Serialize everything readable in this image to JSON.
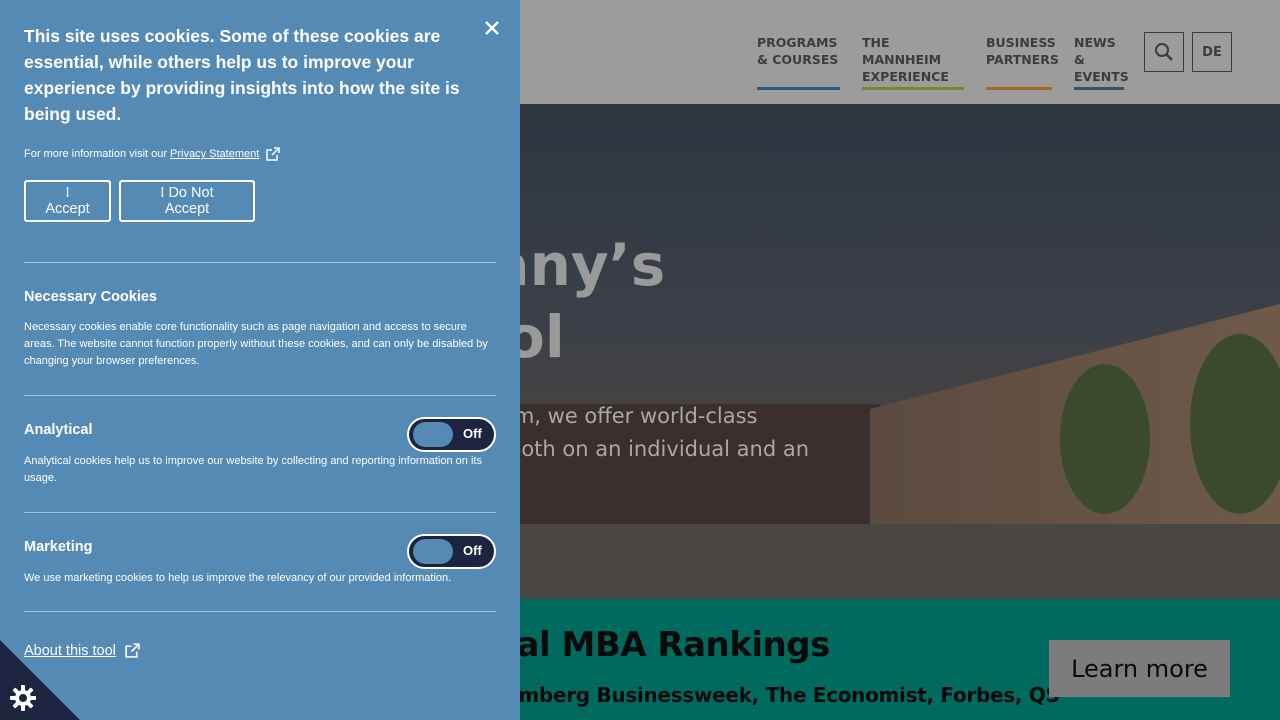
{
  "site": {
    "nav": [
      {
        "line1": "PROGRAMS",
        "line2": "& COURSES"
      },
      {
        "line1": "THE MANNHEIM",
        "line2": "EXPERIENCE"
      },
      {
        "line1": "BUSINESS",
        "line2": "PARTNERS"
      },
      {
        "line1": "NEWS &",
        "line2": "EVENTS"
      }
    ],
    "lang_label": "DE",
    "search_icon": "search-icon",
    "hero": {
      "title_line1": "many’s",
      "title_line2": "ol",
      "text_line1": "im, we offer world-class",
      "text_line2": "both on an individual and an"
    },
    "banner": {
      "title": "onal MBA Rankings",
      "subtitle": "Bloomberg Businessweek, The Economist, Forbes, QS",
      "cta": "Learn more"
    }
  },
  "cookie_panel": {
    "heading": "This site uses cookies. Some of these cookies are essential, while others help us to improve your experience by providing insights into how the site is being used.",
    "more_info_prefix": "For more information visit our",
    "privacy_link": "Privacy Statement",
    "accept_label": "I Accept",
    "deny_label": "I Do Not Accept",
    "sections": [
      {
        "title": "Necessary Cookies",
        "description": "Necessary cookies enable core functionality such as page navigation and access to secure areas. The website cannot function properly without these cookies, and can only be disabled by changing your browser preferences."
      },
      {
        "title": "Analytical",
        "description": "Analytical cookies help us to improve our website by collecting and reporting information on its usage.",
        "toggle_state": "Off"
      },
      {
        "title": "Marketing",
        "description": "We use marketing cookies to help us improve the relevancy of our provided information.",
        "toggle_state": "Off"
      }
    ],
    "about_link": "About this tool",
    "colors": {
      "panel_bg": "#558ab4",
      "toggle_bg": "#1c2440",
      "corner_bg": "#1c2440"
    }
  }
}
